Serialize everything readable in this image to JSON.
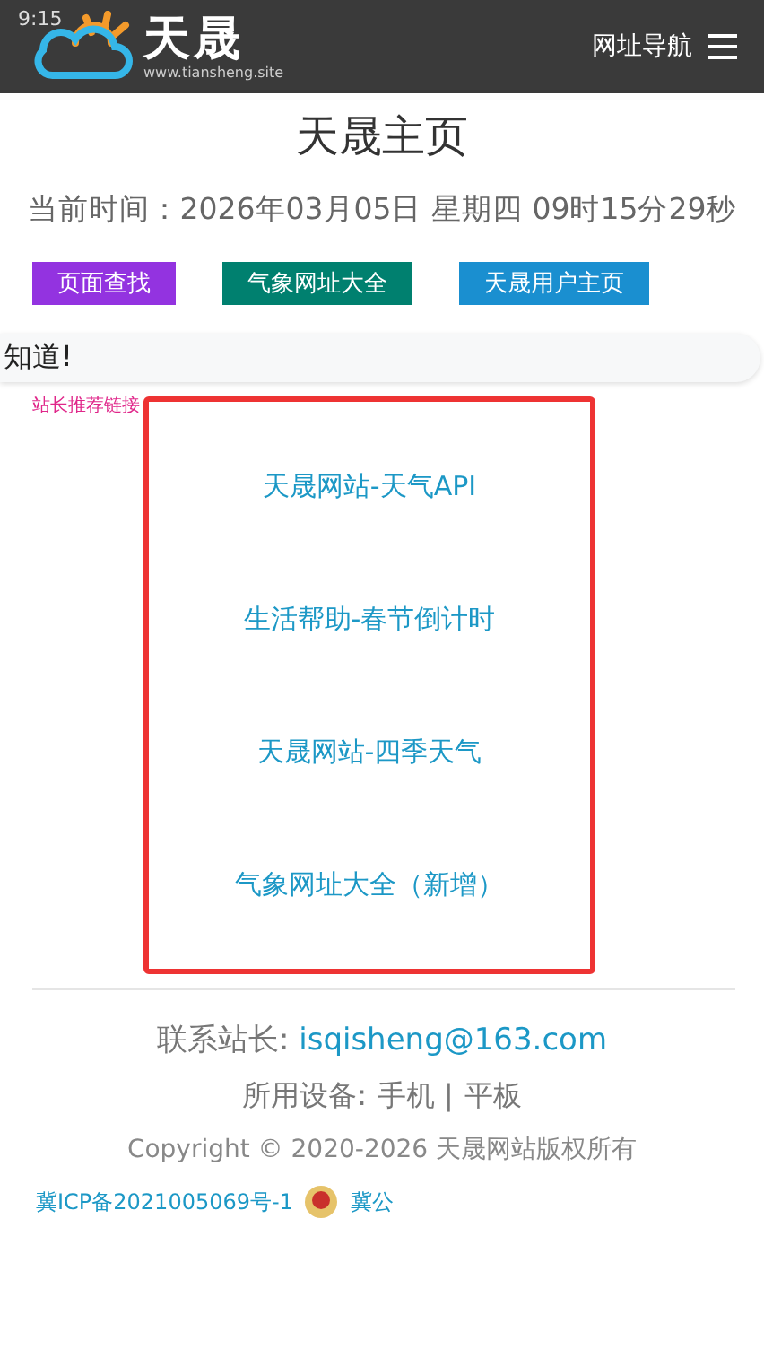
{
  "header": {
    "status_time": "9:15",
    "logo_text": "天晟",
    "logo_url": "www.tiansheng.site",
    "nav_label": "网址导航"
  },
  "page_title": "天晟主页",
  "current_time": "当前时间：2026年03月05日 星期四 09时15分29秒",
  "buttons": [
    {
      "label": "页面查找",
      "color": "#9333e0"
    },
    {
      "label": "气象网址大全",
      "color": "#00806f"
    },
    {
      "label": "天晟用户主页",
      "color": "#1a8fd0"
    }
  ],
  "notice": "知道!",
  "recommend_label": "站长推荐链接",
  "links": [
    "天晟网站-天气API",
    "生活帮助-春节倒计时",
    "天晟网站-四季天气",
    "气象网址大全（新增）"
  ],
  "footer": {
    "contact_label": "联系站长: ",
    "contact_email": "isqisheng@163.com",
    "devices_label": "所用设备: ",
    "devices": [
      "手机 |",
      "平板"
    ],
    "copyright": "Copyright © 2020-2026 天晟网站版权所有",
    "icp": "冀ICP备2021005069号-1",
    "police": "冀公"
  }
}
